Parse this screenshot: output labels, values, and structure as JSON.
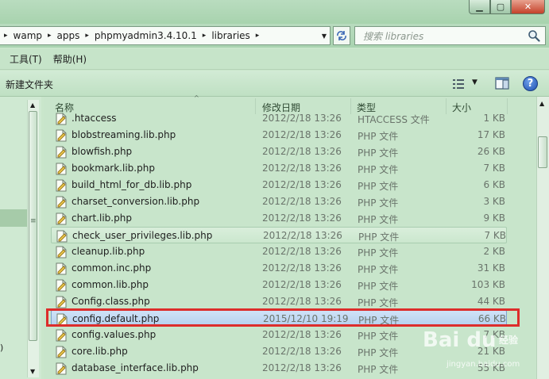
{
  "window": {
    "min_glyph": "▁",
    "max_glyph": "▢",
    "close_glyph": "✕"
  },
  "address": {
    "crumbs": [
      "wamp",
      "apps",
      "phpmyadmin3.4.10.1",
      "libraries"
    ],
    "search_placeholder": "搜索 libraries"
  },
  "menu": {
    "items": [
      "工具(T)",
      "帮助(H)"
    ]
  },
  "toolbar": {
    "new_folder_label": "新建文件夹",
    "help_glyph": "?"
  },
  "columns": {
    "name": "名称",
    "date": "修改日期",
    "type": "类型",
    "size": "大小"
  },
  "files": [
    {
      "name": ".htaccess",
      "date": "2012/2/18 13:26",
      "type": "HTACCESS 文件",
      "size": "1 KB"
    },
    {
      "name": "blobstreaming.lib.php",
      "date": "2012/2/18 13:26",
      "type": "PHP 文件",
      "size": "17 KB"
    },
    {
      "name": "blowfish.php",
      "date": "2012/2/18 13:26",
      "type": "PHP 文件",
      "size": "26 KB"
    },
    {
      "name": "bookmark.lib.php",
      "date": "2012/2/18 13:26",
      "type": "PHP 文件",
      "size": "7 KB"
    },
    {
      "name": "build_html_for_db.lib.php",
      "date": "2012/2/18 13:26",
      "type": "PHP 文件",
      "size": "6 KB"
    },
    {
      "name": "charset_conversion.lib.php",
      "date": "2012/2/18 13:26",
      "type": "PHP 文件",
      "size": "3 KB"
    },
    {
      "name": "chart.lib.php",
      "date": "2012/2/18 13:26",
      "type": "PHP 文件",
      "size": "9 KB"
    },
    {
      "name": "check_user_privileges.lib.php",
      "date": "2012/2/18 13:26",
      "type": "PHP 文件",
      "size": "7 KB"
    },
    {
      "name": "cleanup.lib.php",
      "date": "2012/2/18 13:26",
      "type": "PHP 文件",
      "size": "2 KB"
    },
    {
      "name": "common.inc.php",
      "date": "2012/2/18 13:26",
      "type": "PHP 文件",
      "size": "31 KB"
    },
    {
      "name": "common.lib.php",
      "date": "2012/2/18 13:26",
      "type": "PHP 文件",
      "size": "103 KB"
    },
    {
      "name": "Config.class.php",
      "date": "2012/2/18 13:26",
      "type": "PHP 文件",
      "size": "44 KB"
    },
    {
      "name": "config.default.php",
      "date": "2015/12/10 19:19",
      "type": "PHP 文件",
      "size": "66 KB"
    },
    {
      "name": "config.values.php",
      "date": "2012/2/18 13:26",
      "type": "PHP 文件",
      "size": "7 KB"
    },
    {
      "name": "core.lib.php",
      "date": "2012/2/18 13:26",
      "type": "PHP 文件",
      "size": "21 KB"
    },
    {
      "name": "database_interface.lib.php",
      "date": "2012/2/18 13:26",
      "type": "PHP 文件",
      "size": "55 KB"
    }
  ],
  "nav": {
    "partial_text": ")"
  },
  "watermark": {
    "logo": "Bai du",
    "label": "经验",
    "url": "jingyan.baidu.com"
  }
}
